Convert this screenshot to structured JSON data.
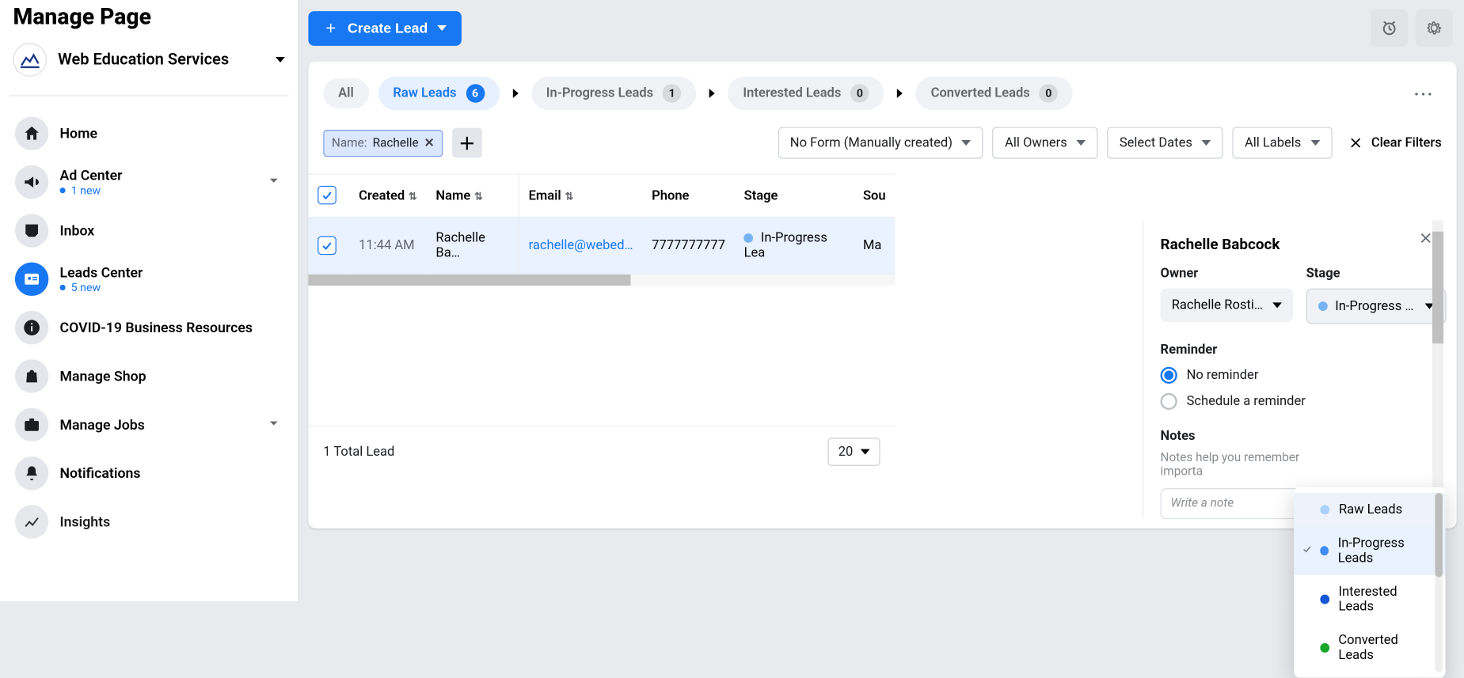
{
  "header": {
    "title": "Manage Page"
  },
  "page_selector": {
    "name": "Web Education Services"
  },
  "sidebar": {
    "items": [
      {
        "label": "Home"
      },
      {
        "label": "Ad Center",
        "sub": "1 new",
        "expandable": true
      },
      {
        "label": "Inbox"
      },
      {
        "label": "Leads Center",
        "sub": "5 new",
        "active": true
      },
      {
        "label": "COVID-19 Business Resources"
      },
      {
        "label": "Manage Shop"
      },
      {
        "label": "Manage Jobs",
        "expandable": true
      },
      {
        "label": "Notifications"
      },
      {
        "label": "Insights"
      }
    ]
  },
  "toolbar": {
    "create_label": "Create Lead"
  },
  "tabs": {
    "all": "All",
    "raw": {
      "label": "Raw Leads",
      "count": "6"
    },
    "inprogress": {
      "label": "In-Progress Leads",
      "count": "1"
    },
    "interested": {
      "label": "Interested Leads",
      "count": "0"
    },
    "converted": {
      "label": "Converted Leads",
      "count": "0"
    }
  },
  "filters": {
    "tag_key": "Name:",
    "tag_value": "Rachelle",
    "form": "No Form (Manually created)",
    "owners": "All Owners",
    "dates": "Select Dates",
    "labels": "All Labels",
    "clear": "Clear Filters"
  },
  "columns": {
    "created": "Created",
    "name": "Name",
    "email": "Email",
    "phone": "Phone",
    "stage": "Stage",
    "source": "Sou"
  },
  "rows": [
    {
      "created": "11:44 AM",
      "name": "Rachelle Ba…",
      "email": "rachelle@webed…",
      "phone": "7777777777",
      "stage": "In-Progress Lea",
      "source": "Ma"
    }
  ],
  "footer": {
    "total": "1 Total Lead",
    "page_size": "20"
  },
  "details": {
    "title": "Rachelle Babcock",
    "owner_label": "Owner",
    "owner_value": "Rachelle Rostis …",
    "stage_label": "Stage",
    "stage_value": "In-Progress Lea",
    "reminder_label": "Reminder",
    "reminder_none": "No reminder",
    "reminder_sched": "Schedule a reminder",
    "notes_label": "Notes",
    "notes_hint": "Notes help you remember importa",
    "notes_placeholder": "Write a note"
  },
  "stage_menu": {
    "raw": "Raw Leads",
    "inprogress": "In-Progress Leads",
    "interested": "Interested Leads",
    "converted": "Converted Leads"
  }
}
